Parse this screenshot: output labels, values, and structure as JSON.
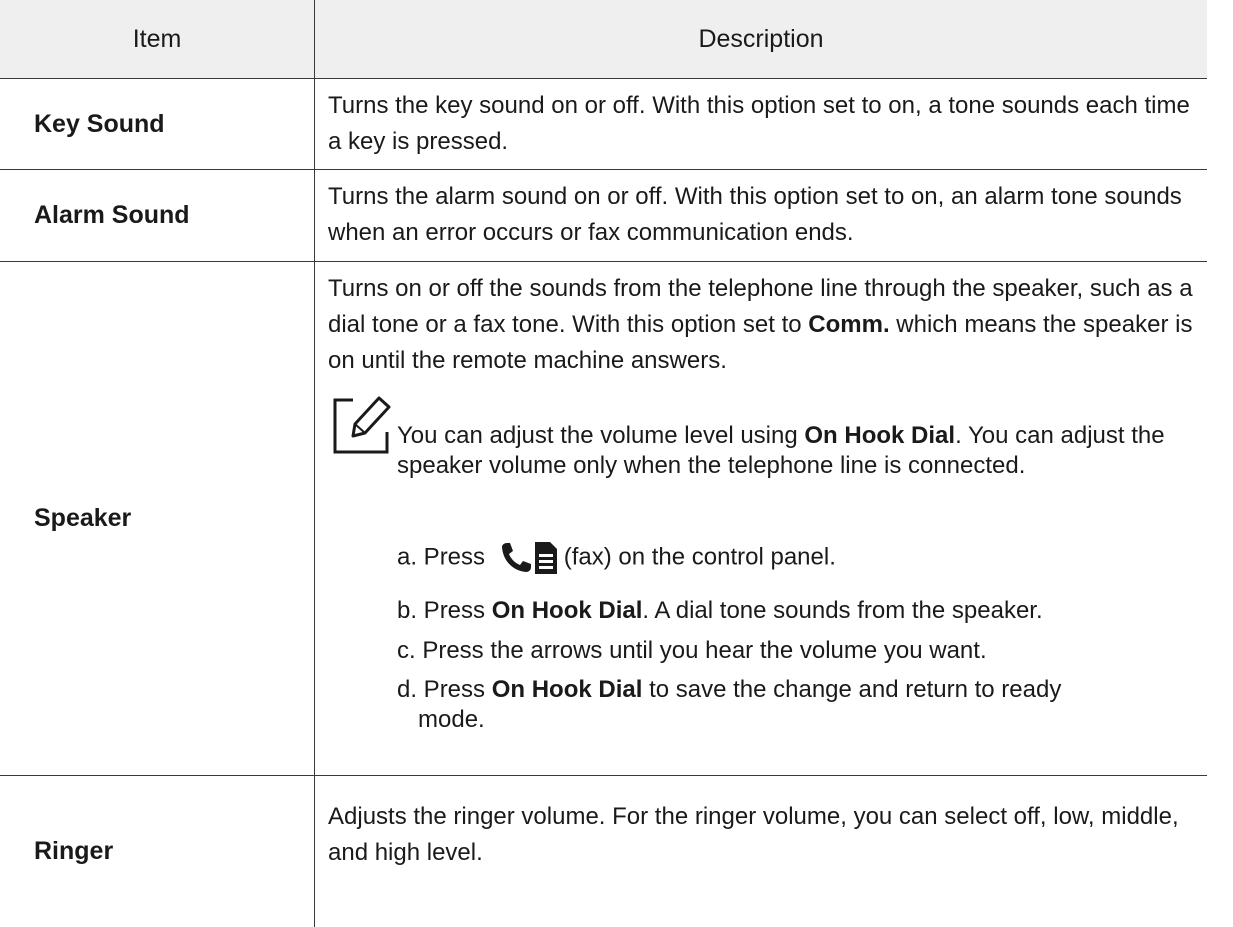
{
  "header": {
    "col_item": "Item",
    "col_description": "Description"
  },
  "rows": [
    {
      "item": "Key Sound",
      "description": "Turns the key sound on or off. With this option set to on, a tone sounds each time a key is pressed."
    },
    {
      "item": "Alarm Sound",
      "description": "Turns the alarm sound on or off. With this option set to on, an alarm tone sounds when an error occurs or fax communication ends."
    },
    {
      "item": "Speaker",
      "description_pre": "Turns on or off the sounds from the telephone line through the speaker, such as a dial tone or a fax tone. With this option set to",
      "description_bold": "Comm.",
      "description_post": "which means the speaker is on until the remote machine answers.",
      "note_pre": "You can adjust the volume level using",
      "note_bold": "On Hook Dial",
      "note_post": ". You can adjust the speaker volume only when the telephone line is connected.",
      "step_a_pre": "a. Press",
      "step_a_post": "(fax) on the control panel.",
      "step_b_pre": "b. Press",
      "step_b_bold": "On Hook Dial",
      "step_b_post": ". A dial tone sounds from the speaker.",
      "step_c": "c. Press the arrows until you hear the volume you want.",
      "step_d_pre": "d. Press",
      "step_d_bold": "On Hook Dial",
      "step_d_post": "to save the change and return to ready",
      "step_d_cont": "mode."
    },
    {
      "item": "Ringer",
      "description": "Adjusts the ringer volume. For the ringer volume, you can select off, low, middle, and high level."
    }
  ],
  "icons": {
    "note": "pencil-note-icon",
    "fax": "phone-document-fax-icon"
  }
}
